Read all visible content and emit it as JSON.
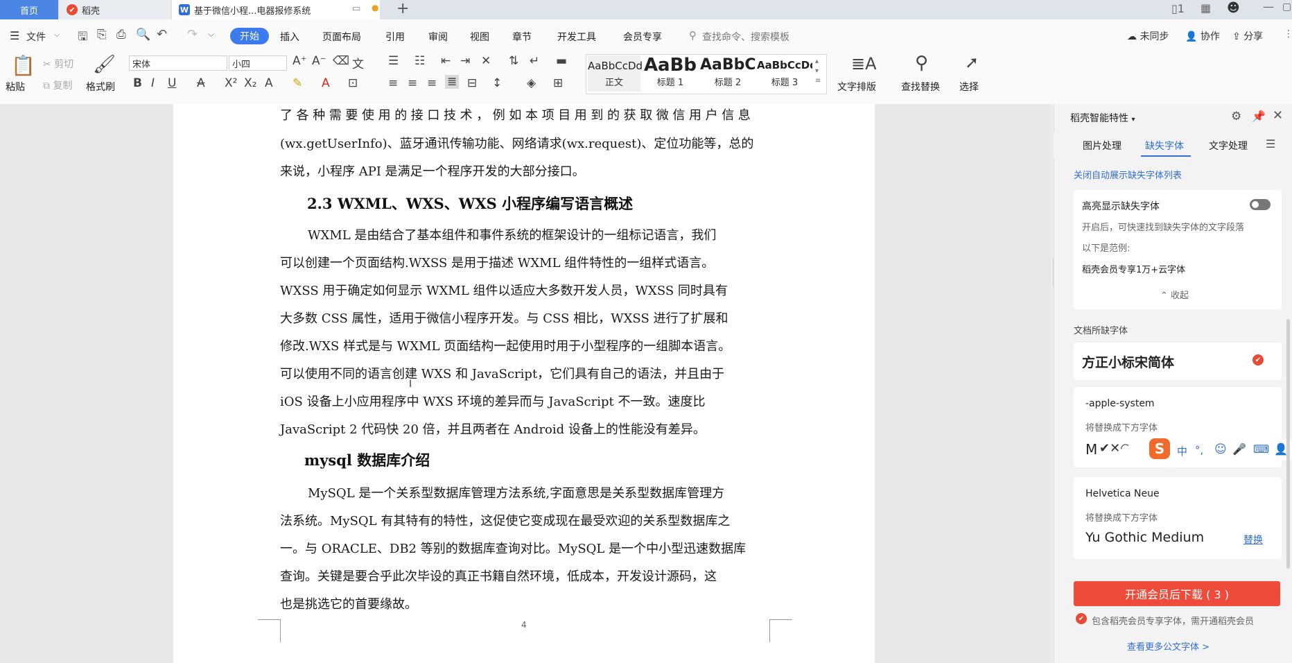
{
  "tabs": {
    "home": "首页",
    "daoke": "稻壳",
    "doc": "基于微信小程...电器报修系统",
    "new_tab": "+"
  },
  "menu": {
    "file": "文件",
    "items": [
      "开始",
      "插入",
      "页面布局",
      "引用",
      "审阅",
      "视图",
      "章节",
      "开发工具",
      "会员专享"
    ],
    "search_placeholder": "查找命令、搜索模板",
    "sync": "未同步",
    "collab": "协作",
    "share": "分享"
  },
  "ribbon": {
    "paste": "粘贴",
    "cut": "剪切",
    "copy": "复制",
    "format_painter": "格式刷",
    "font_name": "宋体",
    "font_size": "小四",
    "styles": [
      {
        "sample": "AaBbCcDd",
        "label": "正文"
      },
      {
        "sample": "AaBb",
        "label": "标题 1"
      },
      {
        "sample": "AaBbC",
        "label": "标题 2"
      },
      {
        "sample": "AaBbCcDd",
        "label": "标题 3"
      }
    ],
    "text_layout": "文字排版",
    "find_replace": "查找替换",
    "select": "选择"
  },
  "doc": {
    "lines_top": [
      "了各种需要使用的接口技术，例如本项目用到的获取微信用户信息",
      "(wx.getUserInfo)、蓝牙通讯传输功能、网络请求(wx.request)、定位功能等，总的",
      "来说，小程序 API 是满足一个程序开发的大部分接口。"
    ],
    "heading1": "2.3 WXML、WXS、WXS 小程序编写语言概述",
    "para2": [
      "WXML 是由结合了基本组件和事件系统的框架设计的一组标记语言，我们",
      "可以创建一个页面结构.WXSS 是用于描述 WXML 组件特性的一组样式语言。",
      "WXSS 用于确定如何显示 WXML 组件以适应大多数开发人员，WXSS 同时具有",
      "大多数 CSS 属性，适用于微信小程序开发。与 CSS 相比，WXSS 进行了扩展和",
      "修改.WXS 样式是与 WXML 页面结构一起使用时用于小型程序的一组脚本语言。",
      "可以使用不同的语言创建 WXS 和 JavaScript，它们具有自己的语法，并且由于",
      "iOS 设备上小应用程序中 WXS 环境的差异而与 JavaScript 不一致。速度比",
      "JavaScript 2 代码快 20 倍，并且两者在 Android 设备上的性能没有差异。"
    ],
    "heading2": "mysql 数据库介绍",
    "para3": [
      "MySQL 是一个关系型数据库管理方法系统,字面意思是关系型数据库管理方",
      "法系统。MySQL 有其特有的特性，这促使它变成现在最受欢迎的关系型数据库之",
      "一。与 ORACLE、DB2 等别的数据库查询对比。MySQL 是一个中小型迅速数据库",
      "查询。关键是要合乎此次毕设的真正书籍自然环境，低成本，开发设计源码，这",
      "也是挑选它的首要缘故。"
    ],
    "page_number": "4"
  },
  "panel": {
    "title": "稻壳智能特性",
    "tabs": [
      "图片处理",
      "缺失字体",
      "文字处理"
    ],
    "close_auto": "关闭自动展示缺失字体列表",
    "highlight_title": "高亮显示缺失字体",
    "highlight_desc": "开启后，可快速找到缺失字体的文字段落",
    "example_label": "以下是范例:",
    "example_value": "稻壳会员专享1万+云字体",
    "collapse": "收起",
    "missing_label": "文档所缺字体",
    "missing_font": "方正小标宋简体",
    "font2": "-apple-system",
    "replace_hint": "将替换成下方字体",
    "font2_sample": "M",
    "font3": "Helvetica Neue",
    "font3_replace": "Yu Gothic Medium",
    "replace_link": "替换",
    "download": "开通会员后下载 ( 3 )",
    "member_note": "包含稻壳会员专享字体，需开通稻壳会员",
    "more_link": "查看更多公文字体 >",
    "ime_items": [
      "中",
      "°,",
      "☺",
      "🎤",
      "⌨"
    ]
  },
  "colors": {
    "accent": "#3c7af0",
    "download": "#ee4b3a",
    "link": "#2f6fd6",
    "brand_red": "#e84a34"
  }
}
